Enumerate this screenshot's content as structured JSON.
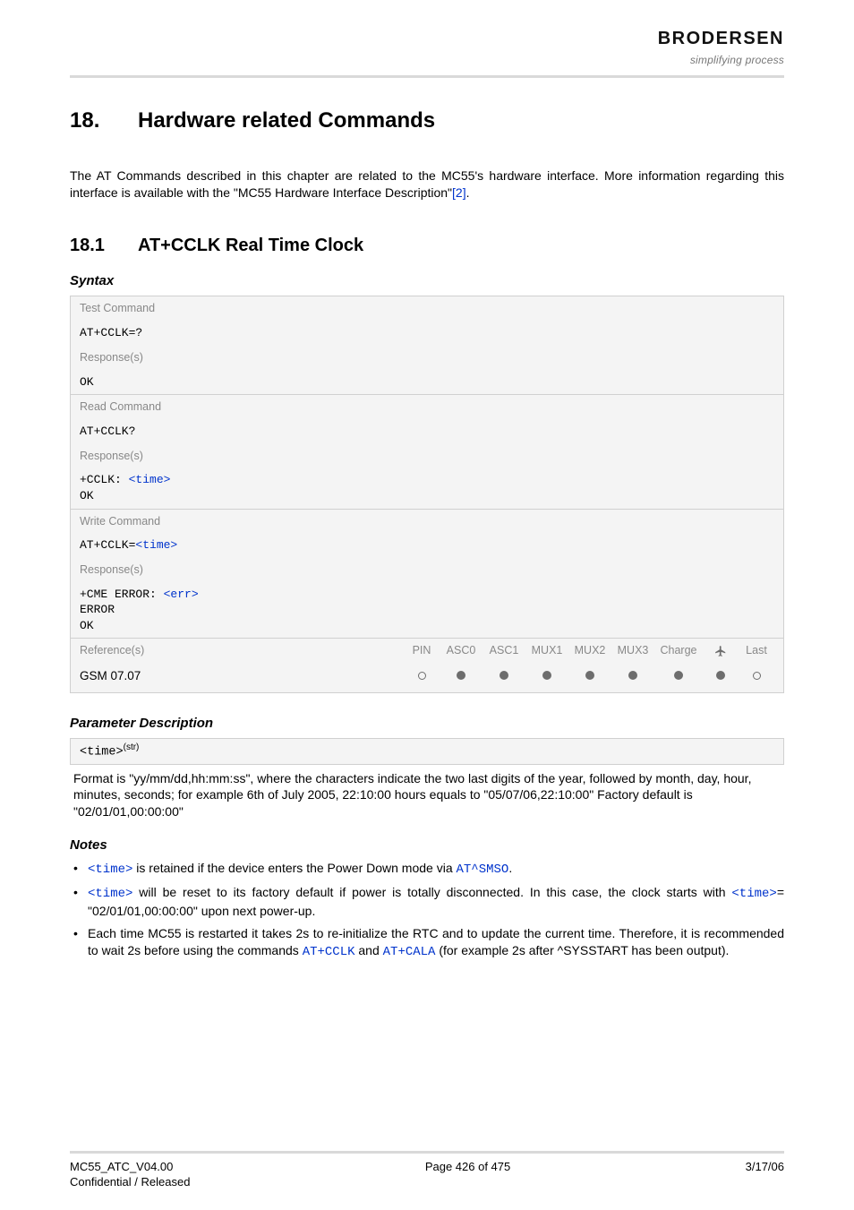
{
  "logo": {
    "word": "BRODERSEN",
    "sub": "simplifying process"
  },
  "section": {
    "num": "18.",
    "title": "Hardware related Commands"
  },
  "intro": {
    "text_a": "The AT Commands described in this chapter are related to the MC55's hardware interface. More information regarding this interface is available with the \"MC55 Hardware Interface Description\"",
    "ref": "[2]",
    "text_b": "."
  },
  "subsection": {
    "num": "18.1",
    "title": "AT+CCLK   Real Time Clock"
  },
  "labels": {
    "syntax": "Syntax",
    "param_desc": "Parameter Description",
    "notes": "Notes",
    "test_cmd": "Test Command",
    "read_cmd": "Read Command",
    "write_cmd": "Write Command",
    "responses": "Response(s)",
    "references": "Reference(s)"
  },
  "syntax": {
    "test_cmd": "AT+CCLK=?",
    "test_resp": "OK",
    "read_cmd": "AT+CCLK?",
    "read_resp_a": "+CCLK: ",
    "read_resp_param": "<time>",
    "read_resp_b": "OK",
    "write_cmd_a": "AT+CCLK=",
    "write_cmd_param": "<time>",
    "write_resp_a": "+CME ERROR: ",
    "write_resp_err": "<err>",
    "write_resp_b": "ERROR",
    "write_resp_c": "OK"
  },
  "refs": {
    "headers": [
      "PIN",
      "ASC0",
      "ASC1",
      "MUX1",
      "MUX2",
      "MUX3",
      "Charge",
      "airplane",
      "Last"
    ],
    "gsm": "GSM 07.07",
    "row": [
      "open",
      "filled",
      "filled",
      "filled",
      "filled",
      "filled",
      "filled",
      "filled",
      "open"
    ]
  },
  "param": {
    "name": "<time>",
    "sup": "(str)",
    "desc": "Format is \"yy/mm/dd,hh:mm:ss\", where the characters indicate the two last digits of the year, followed by month, day, hour, minutes, seconds; for example 6th of July 2005, 22:10:00 hours equals to \"05/07/06,22:10:00\" Factory default is \"02/01/01,00:00:00\""
  },
  "notes": {
    "n1_a": " is retained if the device enters the Power Down mode via ",
    "n1_time": "<time>",
    "n1_cmd": "AT^SMSO",
    "n1_b": ".",
    "n2_a": " will be reset to its factory default if power is totally disconnected. In this case, the clock starts with ",
    "n2_time": "<time>",
    "n2_eq": "= \"02/01/01,00:00:00\" upon next power-up.",
    "n3_a": "Each time MC55 is restarted it takes 2s to re-initialize the RTC and to update the current time. Therefore, it is recommended to wait 2s before using the commands ",
    "n3_c1": "AT+CCLK",
    "n3_and": " and ",
    "n3_c2": "AT+CALA",
    "n3_b": " (for example 2s after ^SYSSTART has been output)."
  },
  "footer": {
    "left1": "MC55_ATC_V04.00",
    "left2": "Confidential / Released",
    "center": "Page 426 of 475",
    "right": "3/17/06"
  }
}
